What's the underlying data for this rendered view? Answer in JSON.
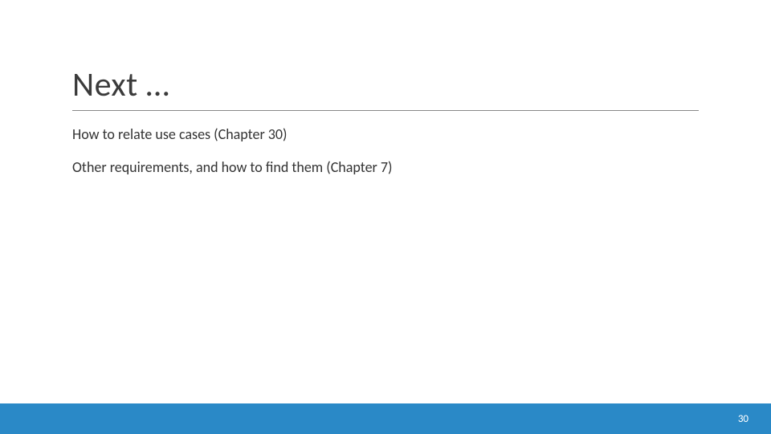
{
  "title": "Next …",
  "bullets": [
    "How to relate use cases (Chapter 30)",
    "Other requirements, and how to find them (Chapter 7)"
  ],
  "page_number": "30",
  "footer_color": "#2a89c7"
}
